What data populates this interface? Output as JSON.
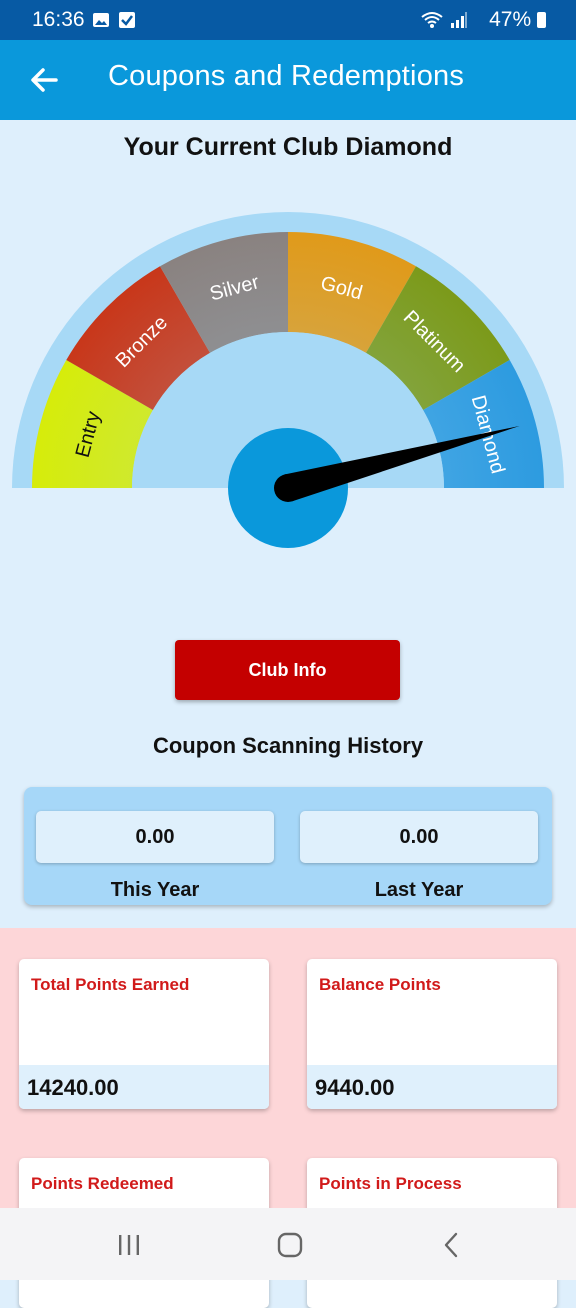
{
  "status": {
    "time": "16:36",
    "battery": "47%"
  },
  "appbar": {
    "title": "Coupons and Redemptions"
  },
  "club": {
    "heading": "Your Current Club Diamond",
    "tiers": [
      "Entry",
      "Bronze",
      "Silver",
      "Gold",
      "Platinum",
      "Diamond"
    ],
    "tier_colors": [
      "#d6ec0a",
      "#c8371a",
      "#8a8280",
      "#e09a1a",
      "#7c9a1a",
      "#2d9be0"
    ],
    "current_tier": "Diamond",
    "button_label": "Club Info"
  },
  "history": {
    "heading": "Coupon Scanning History",
    "this_year_value": "0.00",
    "this_year_label": "This Year",
    "last_year_value": "0.00",
    "last_year_label": "Last Year"
  },
  "points": [
    {
      "label": "Total Points Earned",
      "value": "14240.00"
    },
    {
      "label": "Balance Points",
      "value": "9440.00"
    },
    {
      "label": "Points Redeemed",
      "value": ""
    },
    {
      "label": "Points in Process",
      "value": ""
    }
  ],
  "colors": {
    "statusbar": "#075aa4",
    "appbar": "#0a98db",
    "button": "#c40000",
    "points_label": "#d11a1a",
    "pink_bg": "#fdd6d8"
  }
}
